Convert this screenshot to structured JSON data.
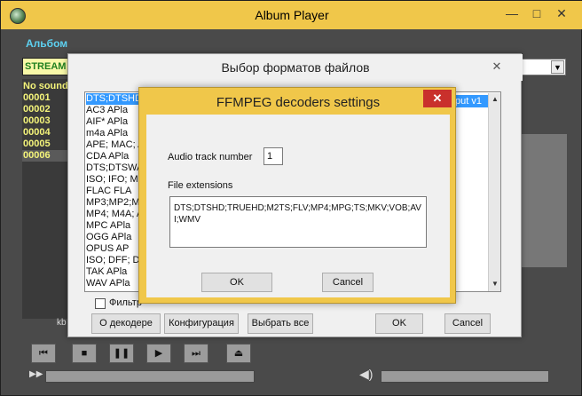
{
  "main": {
    "title": "Album Player",
    "album_label": "Альбом",
    "stream_label": "STREAM",
    "tracks": [
      "No sound",
      "00001",
      "00002",
      "00003",
      "00004",
      "00005",
      "00006"
    ],
    "kb_label": "kb",
    "window_controls": {
      "minimize": "—",
      "maximize": "□",
      "close": "✕"
    },
    "transport_icons": [
      "prev-icon",
      "stop-icon",
      "pause-icon",
      "play-icon",
      "next-icon",
      "eject-icon"
    ]
  },
  "format_dialog": {
    "title": "Выбор форматов файлов",
    "close": "✕",
    "rows": [
      "DTS;DTSHD;",
      "AC3       APla",
      "AIF*      APla",
      "m4a       APla",
      "APE; MAC; A",
      "CDA       APla",
      "DTS;DTSWA",
      "ISO; IFO; ML",
      "FLAC      FLA",
      "MP3;MP2;M",
      "MP4; M4A; A",
      "MPC       APla",
      "OGG       APla",
      "OPUS      AP",
      "ISO; DFF; DS",
      "TAK       APla",
      "WAV       APla"
    ],
    "selected_row_output": "tput v1",
    "filter_label": "Фильтр",
    "buttons": {
      "about_decoder": "О декодере",
      "configuration": "Конфигурация",
      "select_all": "Выбрать все",
      "ok": "OK",
      "cancel": "Cancel"
    }
  },
  "ffmpeg_dialog": {
    "title": "FFMPEG decoders settings",
    "close": "✕",
    "audio_track_label": "Audio track number",
    "audio_track_value": "1",
    "file_extensions_label": "File extensions",
    "file_extensions_value": "DTS;DTSHD;TRUEHD;M2TS;FLV;MP4;MPG;TS;MKV;VOB;AVI;WMV",
    "ok": "OK",
    "cancel": "Cancel"
  },
  "colors": {
    "accent": "#f0c74a",
    "close_red": "#c9302c",
    "selection": "#3399ff",
    "track_text": "#f4f47a",
    "album_label": "#5dd0f0"
  }
}
